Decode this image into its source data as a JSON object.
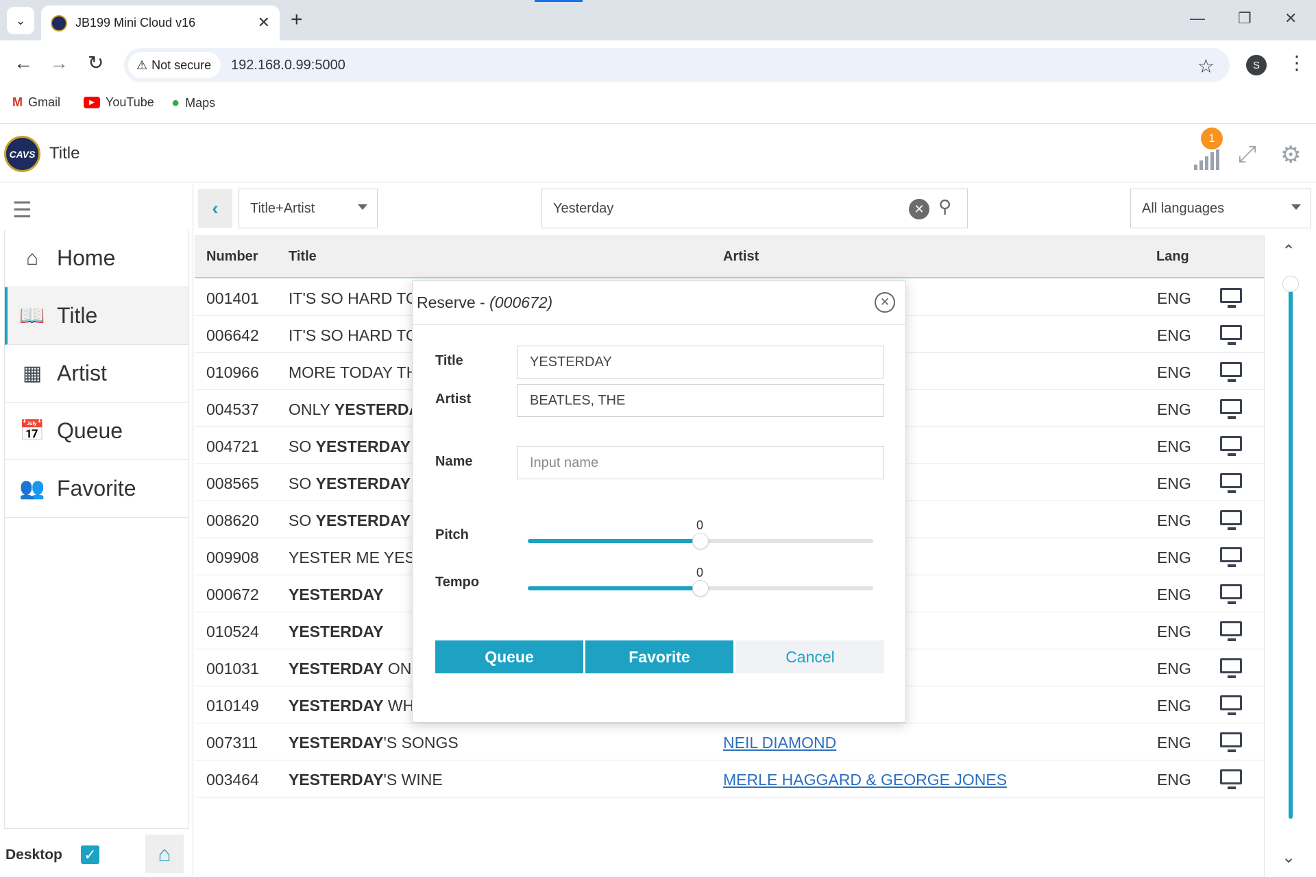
{
  "browser": {
    "tab_title": "JB199 Mini Cloud v16",
    "security_label": "Not secure",
    "url": "192.168.0.99:5000",
    "profile_initial": "S",
    "bookmarks": [
      {
        "label": "Gmail",
        "icon": "gmail-icon"
      },
      {
        "label": "YouTube",
        "icon": "youtube-icon"
      },
      {
        "label": "Maps",
        "icon": "maps-icon"
      }
    ]
  },
  "header": {
    "logo_text": "CAVS",
    "title": "Title",
    "signal_badge": "1"
  },
  "sidebar": {
    "items": [
      {
        "label": "Home",
        "icon": "home-icon"
      },
      {
        "label": "Title",
        "icon": "book-icon",
        "active": true
      },
      {
        "label": "Artist",
        "icon": "table-icon"
      },
      {
        "label": "Queue",
        "icon": "calendar-plus-icon"
      },
      {
        "label": "Favorite",
        "icon": "users-icon"
      }
    ],
    "desktop_label": "Desktop",
    "desktop_checked": true
  },
  "search": {
    "mode": "Title+Artist",
    "query": "Yesterday",
    "language": "All languages"
  },
  "table": {
    "headers": {
      "number": "Number",
      "title": "Title",
      "artist": "Artist",
      "lang": "Lang"
    },
    "rows": [
      {
        "number": "001401",
        "title_pre": "IT'S SO HARD TO",
        "title_bold": "",
        "title_post": "",
        "artist": "",
        "lang": "ENG"
      },
      {
        "number": "006642",
        "title_pre": "IT'S SO HARD TO",
        "title_bold": "",
        "title_post": "",
        "artist": "",
        "lang": "ENG"
      },
      {
        "number": "010966",
        "title_pre": "MORE TODAY TH",
        "title_bold": "",
        "title_post": "",
        "artist": "",
        "lang": "ENG"
      },
      {
        "number": "004537",
        "title_pre": "ONLY ",
        "title_bold": "YESTERDA",
        "title_post": "",
        "artist": "",
        "lang": "ENG"
      },
      {
        "number": "004721",
        "title_pre": "SO ",
        "title_bold": "YESTERDAY",
        "title_post": "",
        "artist": "",
        "lang": "ENG"
      },
      {
        "number": "008565",
        "title_pre": "SO ",
        "title_bold": "YESTERDAY",
        "title_post": "",
        "artist": "",
        "lang": "ENG"
      },
      {
        "number": "008620",
        "title_pre": "SO ",
        "title_bold": "YESTERDAY",
        "title_post": "",
        "artist": "",
        "lang": "ENG"
      },
      {
        "number": "009908",
        "title_pre": "YESTER ME YES",
        "title_bold": "",
        "title_post": "",
        "artist": "",
        "lang": "ENG"
      },
      {
        "number": "000672",
        "title_pre": "",
        "title_bold": "YESTERDAY",
        "title_post": "",
        "artist": "",
        "lang": "ENG"
      },
      {
        "number": "010524",
        "title_pre": "",
        "title_bold": "YESTERDAY",
        "title_post": "",
        "artist": "",
        "lang": "ENG"
      },
      {
        "number": "001031",
        "title_pre": "",
        "title_bold": "YESTERDAY",
        "title_post": " ONC",
        "artist": "",
        "lang": "ENG"
      },
      {
        "number": "010149",
        "title_pre": "",
        "title_bold": "YESTERDAY",
        "title_post": " WH",
        "artist": "",
        "lang": "ENG"
      },
      {
        "number": "007311",
        "title_pre": "",
        "title_bold": "YESTERDAY",
        "title_post": "'S SONGS",
        "artist": "NEIL DIAMOND",
        "lang": "ENG"
      },
      {
        "number": "003464",
        "title_pre": "",
        "title_bold": "YESTERDAY",
        "title_post": "'S WINE",
        "artist": "MERLE HAGGARD & GEORGE JONES",
        "lang": "ENG"
      }
    ]
  },
  "modal": {
    "title": "Reserve - ",
    "number": "(000672)",
    "title_label": "Title",
    "title_value": "YESTERDAY",
    "artist_label": "Artist",
    "artist_value": "BEATLES, THE",
    "name_label": "Name",
    "name_placeholder": "Input name",
    "pitch_label": "Pitch",
    "pitch_value": "0",
    "pitch_fraction": 0.5,
    "tempo_label": "Tempo",
    "tempo_value": "0",
    "tempo_fraction": 0.5,
    "queue_label": "Queue",
    "favorite_label": "Favorite",
    "cancel_label": "Cancel"
  },
  "colors": {
    "accent": "#1ea2c4",
    "badge": "#f7931e",
    "link": "#2a6fc0"
  }
}
